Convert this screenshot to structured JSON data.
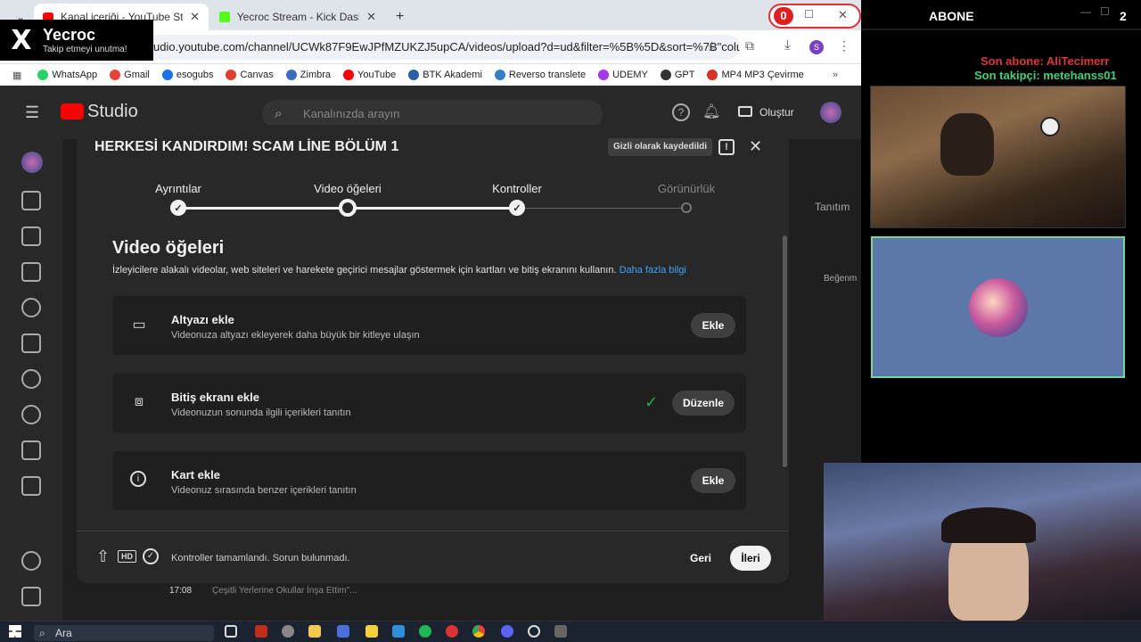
{
  "browser": {
    "tabs": [
      {
        "label": "Kanal içeriği - YouTube Studio",
        "active": true
      },
      {
        "label": "Yecroc Stream - Kick Dashboard",
        "active": false
      }
    ],
    "url": "udio.youtube.com/channel/UCWk87F9EwJPfMZUKZJ5upCA/videos/upload?d=ud&filter=%5B%5D&sort=%7B\"colu...",
    "profile_initial": "S",
    "notification_count": "0",
    "bookmarks": [
      "WhatsApp",
      "Gmail",
      "esogubs",
      "Canvas",
      "Zimbra",
      "YouTube",
      "BTK Akademi",
      "Reverso translete",
      "UDEMY",
      "GPT",
      "MP4 MP3 Çevirme"
    ]
  },
  "x_overlay": {
    "logo": "X",
    "name": "Yecroc",
    "subtitle": "Takip etmeyi unutma!"
  },
  "studio": {
    "logo_text": "Studio",
    "search_placeholder": "Kanalınızda arayın",
    "create_label": "Oluştur",
    "bg_column_label": "Tanıtım",
    "bg_likes_label": "Beğenm",
    "bg_video_time": "17:08",
    "bg_video_title": "Çeşitli Yerlerine Okullar İnşa Ettim\"..."
  },
  "modal": {
    "title": "HERKESİ KANDIRDIM! SCAM LİNE BÖLÜM 1",
    "saved_badge": "Gizli olarak kaydedildi",
    "steps": [
      {
        "label": "Ayrıntılar",
        "state": "done"
      },
      {
        "label": "Video öğeleri",
        "state": "current"
      },
      {
        "label": "Kontroller",
        "state": "done"
      },
      {
        "label": "Görünürlük",
        "state": "pending"
      }
    ],
    "section_title": "Video öğeleri",
    "section_desc": "İzleyicilere alakalı videolar, web siteleri ve harekete geçirici mesajlar göstermek için kartları ve bitiş ekranını kullanın.",
    "learn_more": "Daha fazla bilgi",
    "cards": [
      {
        "title": "Altyazı ekle",
        "desc": "Videonuza altyazı ekleyerek daha büyük bir kitleye ulaşın",
        "button": "Ekle",
        "done": false
      },
      {
        "title": "Bitiş ekranı ekle",
        "desc": "Videonuzun sonunda ilgili içerikleri tanıtın",
        "button": "Düzenle",
        "done": true
      },
      {
        "title": "Kart ekle",
        "desc": "Videonuz sırasında benzer içerikleri tanıtın",
        "button": "Ekle",
        "done": false
      }
    ],
    "footer_status": "Kontroller tamamlandı. Sorun bulunmadı.",
    "footer_hd": "HD",
    "back_label": "Geri",
    "next_label": "İleri"
  },
  "stream_overlay": {
    "abone_label": "ABONE",
    "abone_count": "2",
    "last_sub": "Son abone: AliTecimerr",
    "last_follow": "Son takipçi: metehanss01"
  },
  "taskbar": {
    "search_placeholder": "Ara"
  }
}
